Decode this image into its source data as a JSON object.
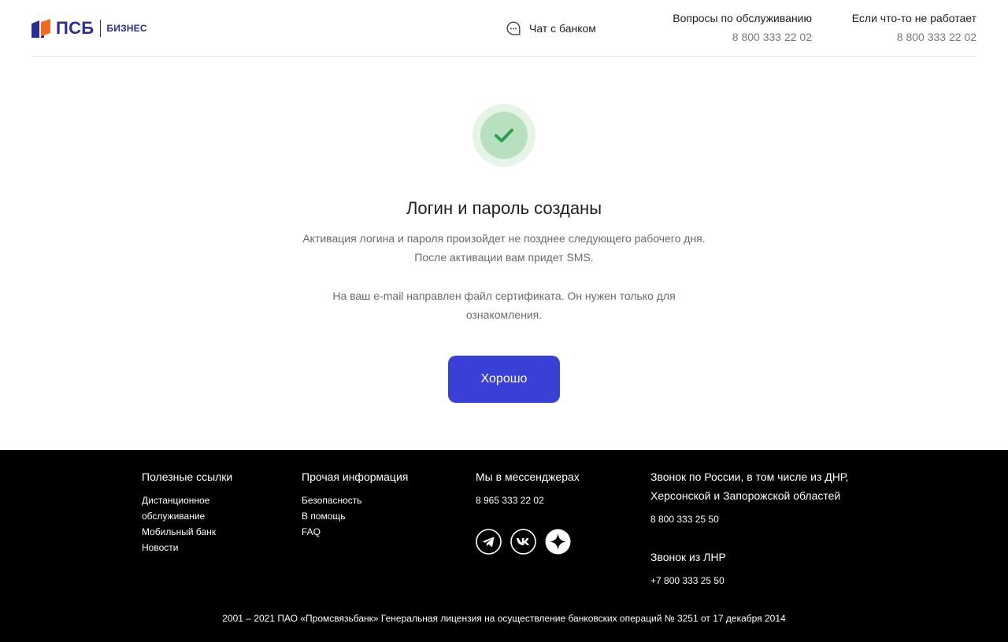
{
  "header": {
    "logo_text": "ПСБ",
    "logo_sub": "БИЗНЕС",
    "chat_label": "Чат с банком",
    "contacts": [
      {
        "title": "Вопросы по обслуживанию",
        "phone": "8 800 333 22 02"
      },
      {
        "title": "Если что-то не работает",
        "phone": "8 800 333 22 02"
      }
    ]
  },
  "main": {
    "title": "Логин и пароль созданы",
    "desc_lines_1": [
      "Активация логина и пароля произойдет не позднее следующего рабочего дня.",
      "После активации вам придет SMS."
    ],
    "desc_lines_2": [
      "На ваш e-mail направлен файл сертификата. Он нужен только для",
      "ознакомления."
    ],
    "button_label": "Хорошо"
  },
  "footer": {
    "col1": {
      "title": "Полезные ссылки",
      "links": [
        "Дистанционное",
        "обслуживание",
        "Мобильный банк",
        "Новости"
      ]
    },
    "col2": {
      "title": "Прочая информация",
      "links": [
        "Безопасность",
        "В помощь",
        "FAQ"
      ]
    },
    "col3": {
      "title": "Мы в мессенджерах",
      "phone": "8 965 333 22 02",
      "socials": [
        "telegram-icon",
        "vk-icon",
        "sparkle-messenger-icon"
      ]
    },
    "col4": {
      "title_line1": "Звонок по России, в том числе из ДНР,",
      "title_line2": "Херсонской и Запорожской областей",
      "phone": "8 800 333 25 50",
      "title2": "Звонок из ЛНР",
      "phone2": "+7 800 333 25 50"
    },
    "copyright": "2001 – 2021 ПАО «Промсвязьбанк» Генеральная лицензия на осуществление банковских операций № 3251 от 17 декабря 2014"
  },
  "colors": {
    "accent": "#3a3fd6",
    "brand": "#2b2c8f",
    "brand_orange": "#f26a21",
    "success": "#2e9e4f"
  }
}
